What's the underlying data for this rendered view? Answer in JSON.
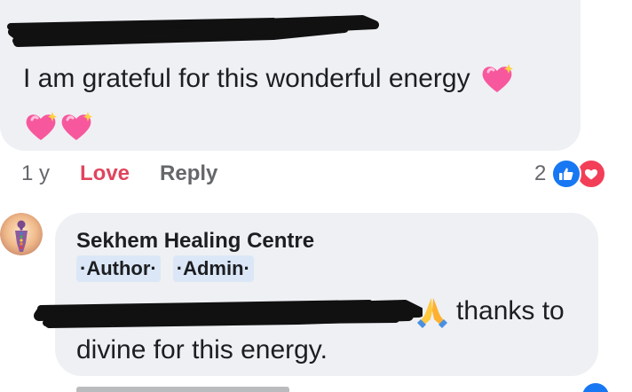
{
  "comment": {
    "text": "I am grateful for this wonderful energy",
    "emoji_icons": [
      "sparkling-heart-icon",
      "sparkling-heart-icon",
      "sparkling-heart-icon"
    ],
    "time": "1 y",
    "love_label": "Love",
    "reply_label": "Reply",
    "reaction_count": "2",
    "reaction_icons": [
      "like-reaction-icon",
      "love-reaction-icon"
    ]
  },
  "reply": {
    "author": "Sekhem Healing Centre",
    "badges": [
      "·Author·",
      "·Admin·"
    ],
    "text_line1": "thanks to",
    "text_line2": "divine for this energy.",
    "emoji_icon": "folded-hands-icon"
  },
  "colors": {
    "bubble": "#eef0f4",
    "love": "#e0455e",
    "muted": "#65676b",
    "like_blue": "#1877f2",
    "love_red": "#f33e58",
    "badge_bg": "#dbe7f6",
    "text": "#1c1e21"
  }
}
